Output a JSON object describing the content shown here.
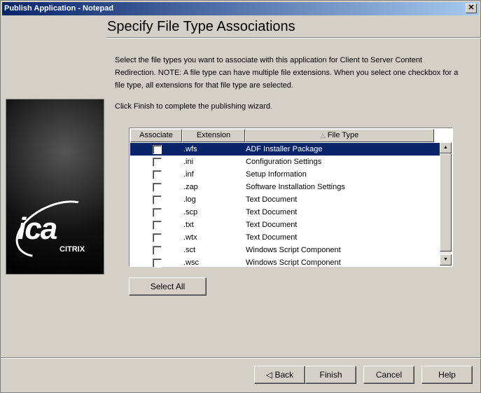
{
  "window": {
    "title": "Publish Application - Notepad",
    "close": "✕"
  },
  "heading": "Specify File Type Associations",
  "intro": "Select the file types you want to associate with this application for Client to Server Content Redirection. NOTE: A file type can have multiple file extensions. When you select one checkbox for a file type, all extensions for that file type are selected.",
  "finish_note": "Click Finish to complete the publishing wizard.",
  "logo": {
    "text": "ica",
    "brand": "CITRIX"
  },
  "table": {
    "columns": [
      "Associate",
      "Extension",
      "File Type"
    ],
    "sort_indicator": "△",
    "rows": [
      {
        "checked": false,
        "ext": ".wfs",
        "type": "ADF Installer Package",
        "selected": true
      },
      {
        "checked": false,
        "ext": ".ini",
        "type": "Configuration Settings"
      },
      {
        "checked": false,
        "ext": ".inf",
        "type": "Setup Information"
      },
      {
        "checked": false,
        "ext": ".zap",
        "type": "Software Installation Settings"
      },
      {
        "checked": false,
        "ext": ".log",
        "type": "Text Document"
      },
      {
        "checked": false,
        "ext": ".scp",
        "type": "Text Document"
      },
      {
        "checked": false,
        "ext": ".txt",
        "type": "Text Document"
      },
      {
        "checked": false,
        "ext": ".wtx",
        "type": "Text Document"
      },
      {
        "checked": false,
        "ext": ".sct",
        "type": "Windows Script Component"
      },
      {
        "checked": false,
        "ext": ".wsc",
        "type": "Windows Script Component"
      }
    ]
  },
  "buttons": {
    "select_all": "Select All",
    "back": "Back",
    "back_arrow": "◁",
    "finish": "Finish",
    "cancel": "Cancel",
    "help": "Help"
  }
}
